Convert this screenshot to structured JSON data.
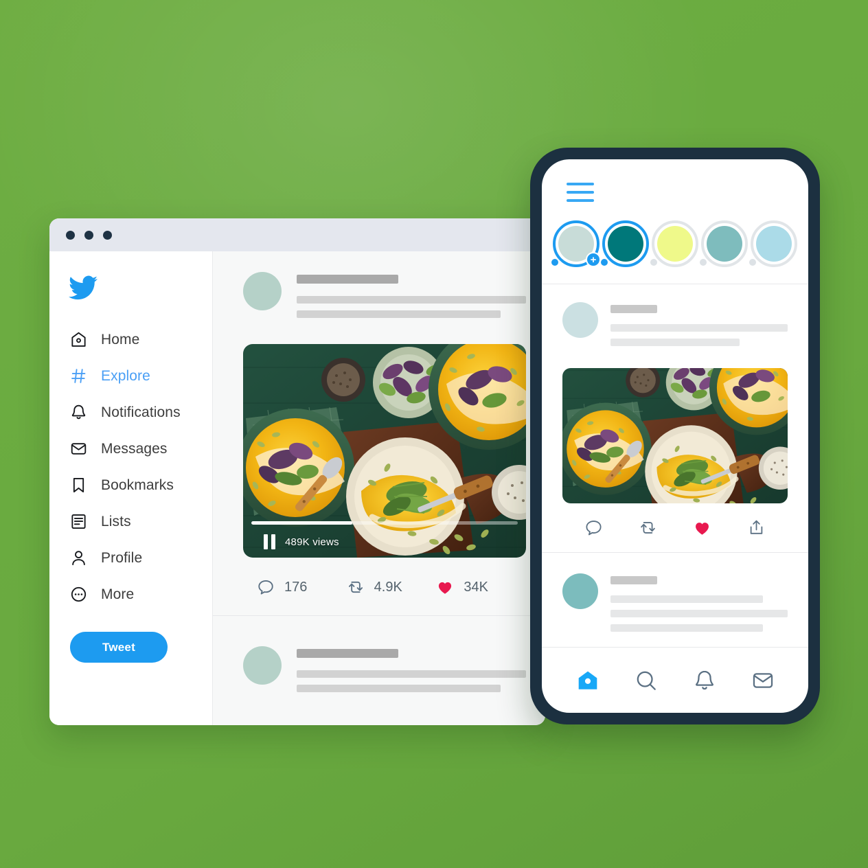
{
  "background": {
    "color": "#6aab40"
  },
  "desktop": {
    "window_title_bar": {
      "dots": 3,
      "color": "#e4e7ee"
    },
    "sidebar": {
      "logo": "twitter-bird-logo",
      "brand_color": "#1d9bf0",
      "items": [
        {
          "label": "Home",
          "icon": "home-icon",
          "active": false
        },
        {
          "label": "Explore",
          "icon": "hashtag-icon",
          "active": true
        },
        {
          "label": "Notifications",
          "icon": "bell-icon",
          "active": false
        },
        {
          "label": "Messages",
          "icon": "envelope-icon",
          "active": false
        },
        {
          "label": "Bookmarks",
          "icon": "bookmark-icon",
          "active": false
        },
        {
          "label": "Lists",
          "icon": "list-icon",
          "active": false
        },
        {
          "label": "Profile",
          "icon": "person-icon",
          "active": false
        },
        {
          "label": "More",
          "icon": "more-circle-icon",
          "active": false
        }
      ],
      "compose_button": {
        "label": "Tweet",
        "color": "#1d9bf0"
      }
    },
    "feed": {
      "post": {
        "avatar_color": "#b5d1c8",
        "media": {
          "type": "video",
          "views_label": "489K views",
          "progress_percent": 38,
          "playback_state": "paused"
        },
        "actions": [
          {
            "name": "reply",
            "icon": "comment-icon",
            "count": "176",
            "active": false
          },
          {
            "name": "retweet",
            "icon": "retweet-icon",
            "count": "4.9K",
            "active": false
          },
          {
            "name": "like",
            "icon": "heart-icon",
            "count": "34K",
            "active": true
          }
        ]
      },
      "post2": {
        "avatar_color": "#b5d1c8"
      }
    }
  },
  "mobile": {
    "frame_color": "#1c3040",
    "menu_icon": "hamburger-menu-icon",
    "stories": [
      {
        "name": "add-story",
        "fill": "#c8dcd8",
        "ring_active": true,
        "has_plus": true
      },
      {
        "name": "story-2",
        "fill": "#00787a",
        "ring_active": true,
        "has_plus": false
      },
      {
        "name": "story-3",
        "fill": "#eff98a",
        "ring_active": false,
        "has_plus": false
      },
      {
        "name": "story-4",
        "fill": "#7ebcbd",
        "ring_active": false,
        "has_plus": false
      },
      {
        "name": "story-5",
        "fill": "#abdbe8",
        "ring_active": false,
        "has_plus": false
      }
    ],
    "post": {
      "avatar_color": "#cbe0e2",
      "actions": [
        {
          "name": "reply",
          "icon": "comment-icon",
          "active": false
        },
        {
          "name": "retweet",
          "icon": "retweet-icon",
          "active": false
        },
        {
          "name": "like",
          "icon": "heart-icon",
          "active": true
        },
        {
          "name": "share",
          "icon": "share-icon",
          "active": false
        }
      ]
    },
    "post2": {
      "avatar_color": "#7cbcbd"
    },
    "bottom_nav": [
      {
        "name": "home",
        "icon": "home-filled-icon",
        "active": true
      },
      {
        "name": "search",
        "icon": "search-icon",
        "active": false
      },
      {
        "name": "notifications",
        "icon": "bell-icon",
        "active": false
      },
      {
        "name": "messages",
        "icon": "envelope-icon",
        "active": false
      }
    ]
  },
  "media_photo": {
    "subject": "pumpkin soup bowls on dark green wood table",
    "palette": {
      "table": "#1f4a3c",
      "soup": "#f5c116",
      "cream": "#f3eddc",
      "herb": "#6f9d3e",
      "purple_basil": "#6a3a62",
      "board": "#5d3222",
      "seed": "#9fae52"
    }
  }
}
